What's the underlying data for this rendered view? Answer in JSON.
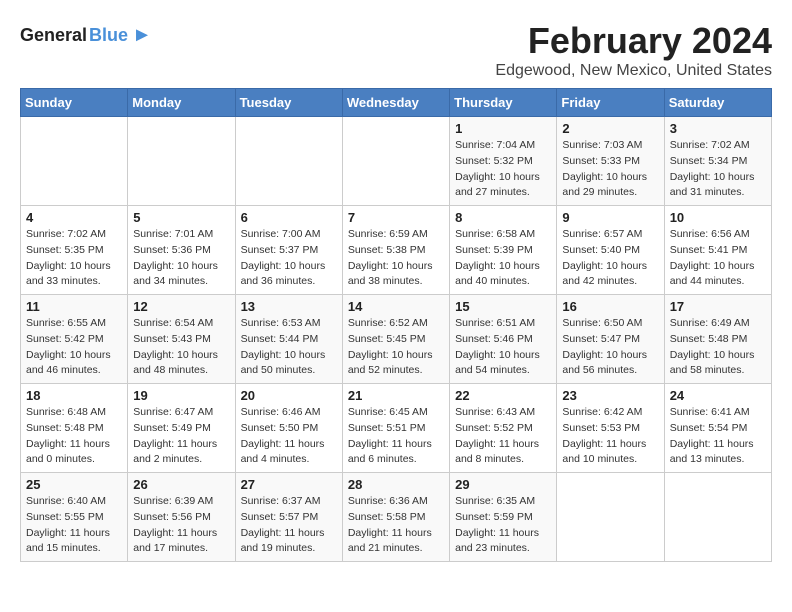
{
  "header": {
    "logo_general": "General",
    "logo_blue": "Blue",
    "title": "February 2024",
    "subtitle": "Edgewood, New Mexico, United States"
  },
  "days_of_week": [
    "Sunday",
    "Monday",
    "Tuesday",
    "Wednesday",
    "Thursday",
    "Friday",
    "Saturday"
  ],
  "weeks": [
    [
      {
        "day": "",
        "info": ""
      },
      {
        "day": "",
        "info": ""
      },
      {
        "day": "",
        "info": ""
      },
      {
        "day": "",
        "info": ""
      },
      {
        "day": "1",
        "info": "Sunrise: 7:04 AM\nSunset: 5:32 PM\nDaylight: 10 hours\nand 27 minutes."
      },
      {
        "day": "2",
        "info": "Sunrise: 7:03 AM\nSunset: 5:33 PM\nDaylight: 10 hours\nand 29 minutes."
      },
      {
        "day": "3",
        "info": "Sunrise: 7:02 AM\nSunset: 5:34 PM\nDaylight: 10 hours\nand 31 minutes."
      }
    ],
    [
      {
        "day": "4",
        "info": "Sunrise: 7:02 AM\nSunset: 5:35 PM\nDaylight: 10 hours\nand 33 minutes."
      },
      {
        "day": "5",
        "info": "Sunrise: 7:01 AM\nSunset: 5:36 PM\nDaylight: 10 hours\nand 34 minutes."
      },
      {
        "day": "6",
        "info": "Sunrise: 7:00 AM\nSunset: 5:37 PM\nDaylight: 10 hours\nand 36 minutes."
      },
      {
        "day": "7",
        "info": "Sunrise: 6:59 AM\nSunset: 5:38 PM\nDaylight: 10 hours\nand 38 minutes."
      },
      {
        "day": "8",
        "info": "Sunrise: 6:58 AM\nSunset: 5:39 PM\nDaylight: 10 hours\nand 40 minutes."
      },
      {
        "day": "9",
        "info": "Sunrise: 6:57 AM\nSunset: 5:40 PM\nDaylight: 10 hours\nand 42 minutes."
      },
      {
        "day": "10",
        "info": "Sunrise: 6:56 AM\nSunset: 5:41 PM\nDaylight: 10 hours\nand 44 minutes."
      }
    ],
    [
      {
        "day": "11",
        "info": "Sunrise: 6:55 AM\nSunset: 5:42 PM\nDaylight: 10 hours\nand 46 minutes."
      },
      {
        "day": "12",
        "info": "Sunrise: 6:54 AM\nSunset: 5:43 PM\nDaylight: 10 hours\nand 48 minutes."
      },
      {
        "day": "13",
        "info": "Sunrise: 6:53 AM\nSunset: 5:44 PM\nDaylight: 10 hours\nand 50 minutes."
      },
      {
        "day": "14",
        "info": "Sunrise: 6:52 AM\nSunset: 5:45 PM\nDaylight: 10 hours\nand 52 minutes."
      },
      {
        "day": "15",
        "info": "Sunrise: 6:51 AM\nSunset: 5:46 PM\nDaylight: 10 hours\nand 54 minutes."
      },
      {
        "day": "16",
        "info": "Sunrise: 6:50 AM\nSunset: 5:47 PM\nDaylight: 10 hours\nand 56 minutes."
      },
      {
        "day": "17",
        "info": "Sunrise: 6:49 AM\nSunset: 5:48 PM\nDaylight: 10 hours\nand 58 minutes."
      }
    ],
    [
      {
        "day": "18",
        "info": "Sunrise: 6:48 AM\nSunset: 5:48 PM\nDaylight: 11 hours\nand 0 minutes."
      },
      {
        "day": "19",
        "info": "Sunrise: 6:47 AM\nSunset: 5:49 PM\nDaylight: 11 hours\nand 2 minutes."
      },
      {
        "day": "20",
        "info": "Sunrise: 6:46 AM\nSunset: 5:50 PM\nDaylight: 11 hours\nand 4 minutes."
      },
      {
        "day": "21",
        "info": "Sunrise: 6:45 AM\nSunset: 5:51 PM\nDaylight: 11 hours\nand 6 minutes."
      },
      {
        "day": "22",
        "info": "Sunrise: 6:43 AM\nSunset: 5:52 PM\nDaylight: 11 hours\nand 8 minutes."
      },
      {
        "day": "23",
        "info": "Sunrise: 6:42 AM\nSunset: 5:53 PM\nDaylight: 11 hours\nand 10 minutes."
      },
      {
        "day": "24",
        "info": "Sunrise: 6:41 AM\nSunset: 5:54 PM\nDaylight: 11 hours\nand 13 minutes."
      }
    ],
    [
      {
        "day": "25",
        "info": "Sunrise: 6:40 AM\nSunset: 5:55 PM\nDaylight: 11 hours\nand 15 minutes."
      },
      {
        "day": "26",
        "info": "Sunrise: 6:39 AM\nSunset: 5:56 PM\nDaylight: 11 hours\nand 17 minutes."
      },
      {
        "day": "27",
        "info": "Sunrise: 6:37 AM\nSunset: 5:57 PM\nDaylight: 11 hours\nand 19 minutes."
      },
      {
        "day": "28",
        "info": "Sunrise: 6:36 AM\nSunset: 5:58 PM\nDaylight: 11 hours\nand 21 minutes."
      },
      {
        "day": "29",
        "info": "Sunrise: 6:35 AM\nSunset: 5:59 PM\nDaylight: 11 hours\nand 23 minutes."
      },
      {
        "day": "",
        "info": ""
      },
      {
        "day": "",
        "info": ""
      }
    ]
  ]
}
